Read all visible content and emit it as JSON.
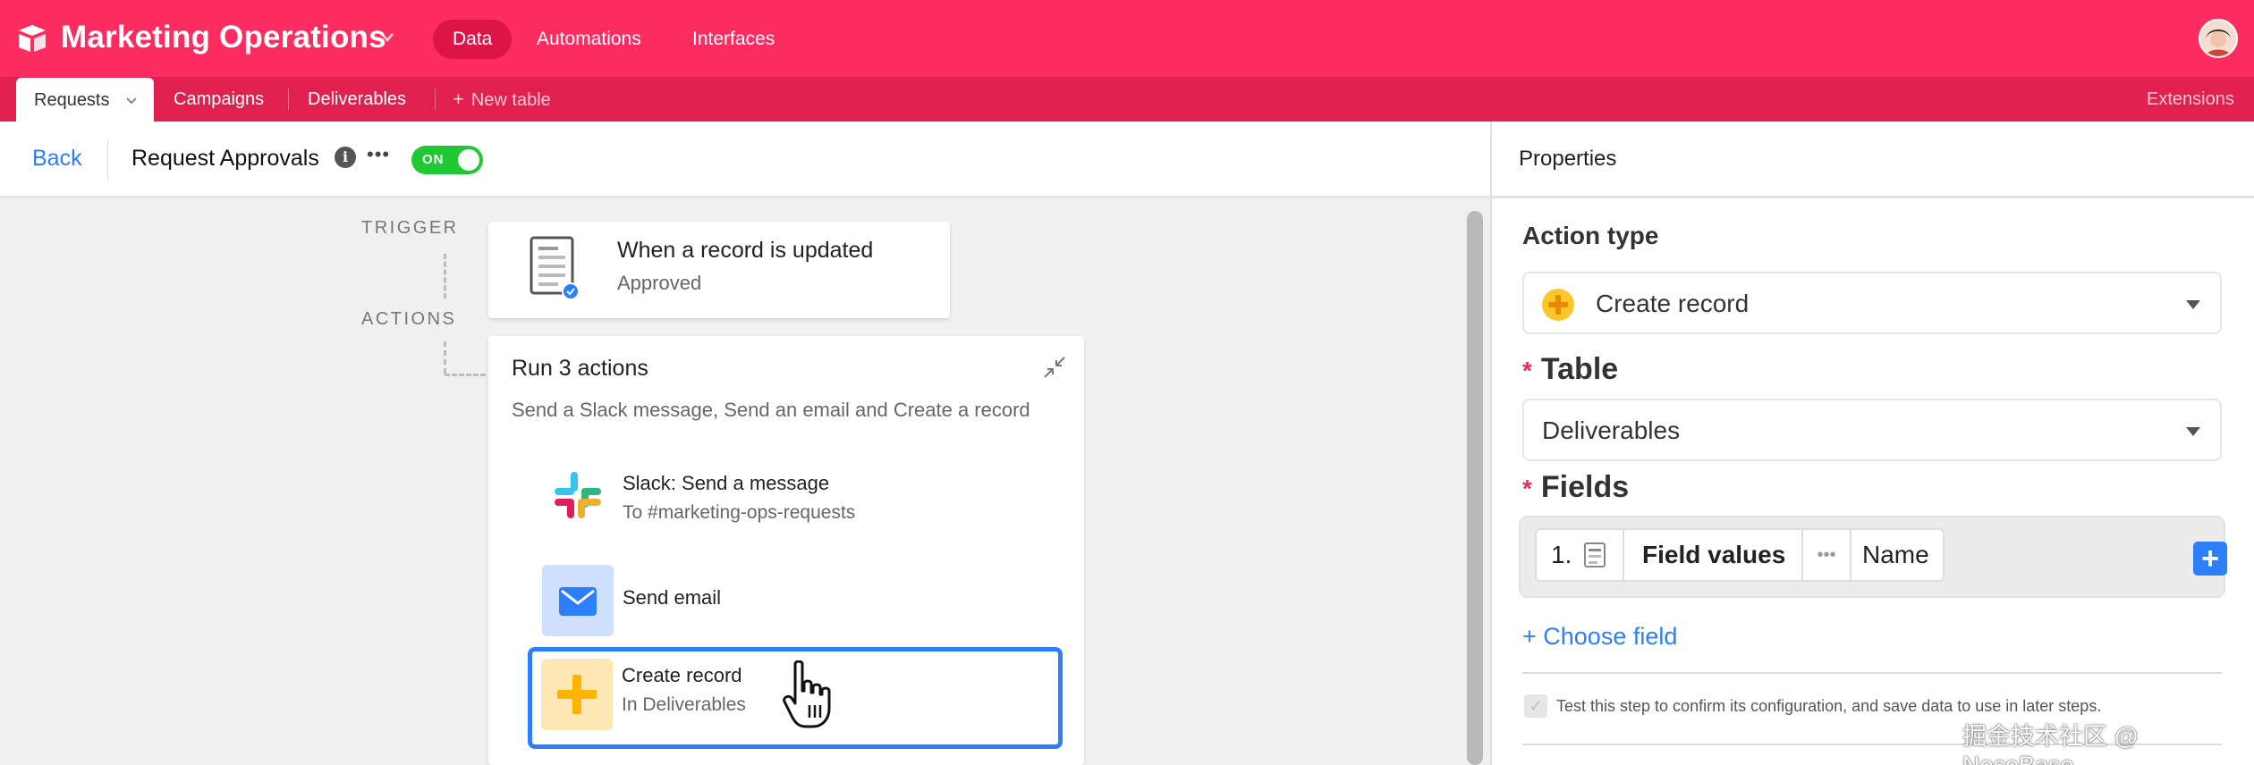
{
  "topbar": {
    "base_title": "Marketing Operations",
    "nav": [
      {
        "label": "Data",
        "active": true
      },
      {
        "label": "Automations",
        "active": false
      },
      {
        "label": "Interfaces",
        "active": false
      }
    ]
  },
  "tabs": {
    "items": [
      "Requests",
      "Campaigns",
      "Deliverables"
    ],
    "new_table": "New table",
    "extensions": "Extensions"
  },
  "header": {
    "back_label": "Back",
    "automation_name": "Request Approvals",
    "toggle_label": "ON",
    "toggle_on": true
  },
  "canvas": {
    "trigger_label": "TRIGGER",
    "actions_label": "ACTIONS",
    "trigger_card": {
      "title": "When a record is updated",
      "subtitle": "Approved"
    },
    "actions_card": {
      "title": "Run 3 actions",
      "subtitle": "Send a Slack message, Send an email and Create a record",
      "items": [
        {
          "title": "Slack: Send a message",
          "subtitle": "To #marketing-ops-requests",
          "icon": "slack-icon"
        },
        {
          "title": "Send email",
          "subtitle": "",
          "icon": "envelope-icon"
        },
        {
          "title": "Create record",
          "subtitle": "In Deliverables",
          "icon": "plus-icon",
          "selected": true
        }
      ]
    }
  },
  "properties": {
    "title": "Properties",
    "action_type_label": "Action type",
    "action_type_value": "Create record",
    "table_label": "Table",
    "table_value": "Deliverables",
    "fields_label": "Fields",
    "field_row": {
      "index": "1.",
      "field": "Field values",
      "value": "Name"
    },
    "choose_field": "+ Choose field",
    "test_text": "Test this step to confirm its configuration, and save data to use in later steps."
  },
  "watermark": "掘金技术社区 @ NocoBase",
  "colors": {
    "brand": "#fc2c60",
    "tabbar": "#e0204f",
    "accent": "#2d7ff9",
    "toggle": "#20c933",
    "create_icon": "#ffc62b"
  }
}
